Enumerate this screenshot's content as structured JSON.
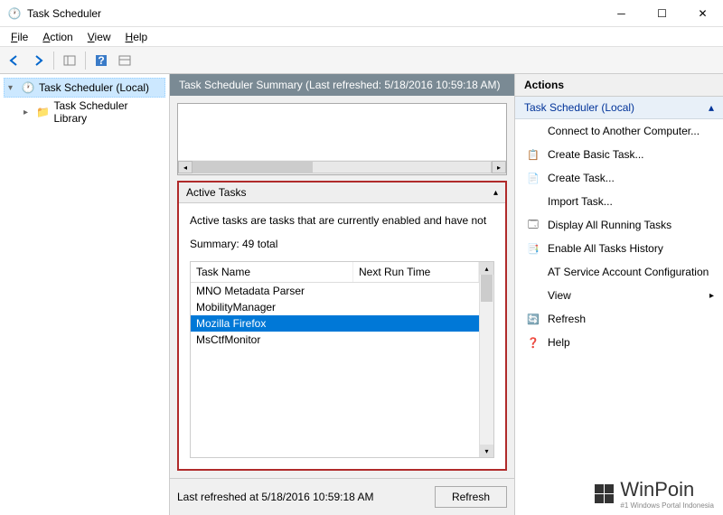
{
  "window": {
    "title": "Task Scheduler"
  },
  "menubar": {
    "file": "File",
    "action": "Action",
    "view": "View",
    "help": "Help"
  },
  "sidebar": {
    "root": "Task Scheduler (Local)",
    "library": "Task Scheduler Library"
  },
  "center": {
    "header": "Task Scheduler Summary (Last refreshed: 5/18/2016 10:59:18 AM)",
    "active_tasks_title": "Active Tasks",
    "active_tasks_desc": "Active tasks are tasks that are currently enabled and have not",
    "summary": "Summary: 49 total",
    "columns": {
      "task_name": "Task Name",
      "next_run": "Next Run Time"
    },
    "rows": [
      {
        "name": "MNO Metadata Parser",
        "selected": false
      },
      {
        "name": "MobilityManager",
        "selected": false
      },
      {
        "name": "Mozilla Firefox",
        "selected": true
      },
      {
        "name": "MsCtfMonitor",
        "selected": false
      }
    ],
    "last_refreshed": "Last refreshed at 5/18/2016 10:59:18 AM",
    "refresh_button": "Refresh"
  },
  "actions": {
    "title": "Actions",
    "subtitle": "Task Scheduler (Local)",
    "items": [
      {
        "label": "Connect to Another Computer...",
        "icon": ""
      },
      {
        "label": "Create Basic Task...",
        "icon": "📋"
      },
      {
        "label": "Create Task...",
        "icon": "📄"
      },
      {
        "label": "Import Task...",
        "icon": ""
      },
      {
        "label": "Display All Running Tasks",
        "icon": "🗔"
      },
      {
        "label": "Enable All Tasks History",
        "icon": "📑"
      },
      {
        "label": "AT Service Account Configuration",
        "icon": ""
      },
      {
        "label": "View",
        "icon": "",
        "submenu": true
      },
      {
        "label": "Refresh",
        "icon": "🔄"
      },
      {
        "label": "Help",
        "icon": "❓"
      }
    ]
  },
  "watermark": {
    "name": "WinPoin",
    "tagline": "#1 Windows Portal Indonesia"
  }
}
